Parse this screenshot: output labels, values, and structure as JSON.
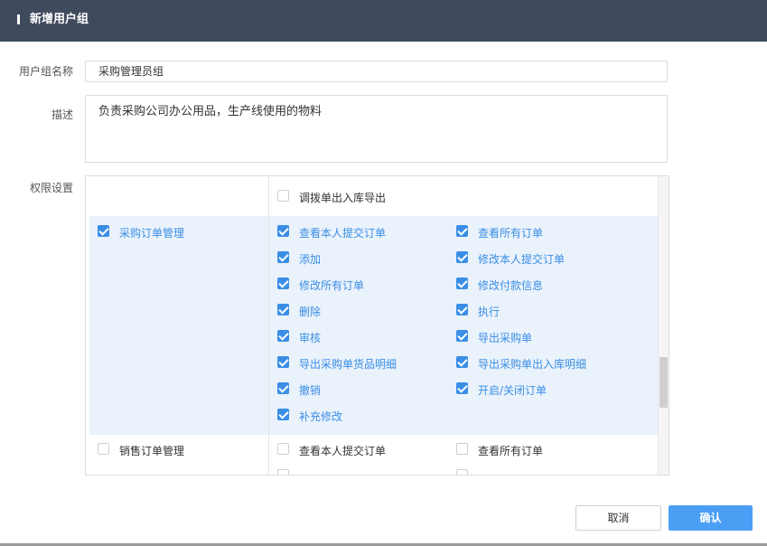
{
  "dialog": {
    "title": "新增用户组"
  },
  "form": {
    "name_label": "用户组名称",
    "name_value": "采购管理员组",
    "desc_label": "描述",
    "desc_value": "负责采购公司办公用品，生产线使用的物料",
    "perm_label": "权限设置"
  },
  "permissions": {
    "top_partial": {
      "label": "调拨单出入库导出",
      "checked": false
    },
    "purchase": {
      "group_label": "采购订单管理",
      "group_checked": true,
      "items": [
        {
          "label": "查看本人提交订单",
          "checked": true
        },
        {
          "label": "查看所有订单",
          "checked": true
        },
        {
          "label": "添加",
          "checked": true
        },
        {
          "label": "修改本人提交订单",
          "checked": true
        },
        {
          "label": "修改所有订单",
          "checked": true
        },
        {
          "label": "修改付款信息",
          "checked": true
        },
        {
          "label": "删除",
          "checked": true
        },
        {
          "label": "执行",
          "checked": true
        },
        {
          "label": "审核",
          "checked": true
        },
        {
          "label": "导出采购单",
          "checked": true
        },
        {
          "label": "导出采购单货品明细",
          "checked": true
        },
        {
          "label": "导出采购单出入库明细",
          "checked": true
        },
        {
          "label": "撤销",
          "checked": true
        },
        {
          "label": "开启/关闭订单",
          "checked": true
        },
        {
          "label": "补充修改",
          "checked": true
        }
      ]
    },
    "sales": {
      "group_label": "销售订单管理",
      "group_checked": false,
      "items": [
        {
          "label": "查看本人提交订单",
          "checked": false
        },
        {
          "label": "查看所有订单",
          "checked": false
        }
      ]
    }
  },
  "buttons": {
    "cancel": "取消",
    "confirm": "确认"
  },
  "colors": {
    "header_bg": "#3f4a5d",
    "accent": "#3a8ee6",
    "highlight_bg": "#eaf2fb",
    "confirm_bg": "#4a9ff5"
  }
}
